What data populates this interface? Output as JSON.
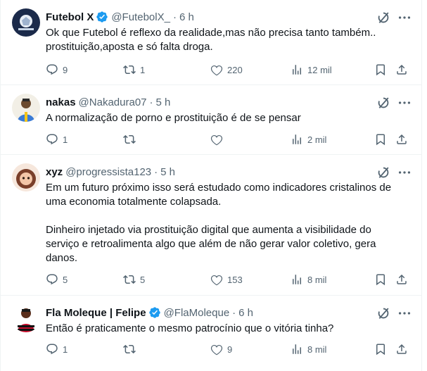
{
  "colors": {
    "text": "#0f1419",
    "secondary": "#536471",
    "verified": "#1d9bf0",
    "divider": "#eff3f4"
  },
  "icons": {
    "reply": "reply-icon",
    "retweet": "retweet-icon",
    "like": "like-icon",
    "views": "views-icon",
    "bookmark": "bookmark-icon",
    "share": "share-icon",
    "grok": "grok-icon",
    "more": "more-icon",
    "verified": "verified-badge-icon"
  },
  "tweets": [
    {
      "name": "Futebol X",
      "verified": true,
      "handle": "@FutebolX_",
      "sep": "·",
      "time": "6 h",
      "text": [
        "Ok que Futebol é reflexo da realidade,mas não precisa tanto também..",
        "prostituição,aposta e só falta droga."
      ],
      "replies": "9",
      "retweets": "1",
      "likes": "220",
      "views": "12 mil"
    },
    {
      "name": "nakas",
      "verified": false,
      "handle": "@Nakadura07",
      "sep": "·",
      "time": "5 h",
      "text": [
        "A normalização de porno e prostituição é de se pensar"
      ],
      "replies": "1",
      "retweets": "",
      "likes": "",
      "views": "2 mil"
    },
    {
      "name": "xyz",
      "verified": false,
      "handle": "@progressista123",
      "sep": "·",
      "time": "5 h",
      "text": [
        "Em um futuro próximo isso será estudado como indicadores cristalinos de",
        "uma economia totalmente colapsada.",
        "",
        "Dinheiro injetado via prostituição digital que aumenta a visibilidade do",
        "serviço e retroalimenta algo que além de não gerar valor coletivo, gera",
        "danos."
      ],
      "replies": "5",
      "retweets": "5",
      "likes": "153",
      "views": "8 mil"
    },
    {
      "name": "Fla Moleque | Felipe",
      "verified": true,
      "handle": "@FlaMoleque",
      "sep": "·",
      "time": "6 h",
      "text": [
        "Então é praticamente o mesmo patrocínio que o vitória tinha?"
      ],
      "replies": "1",
      "retweets": "",
      "likes": "9",
      "views": "8 mil"
    }
  ]
}
